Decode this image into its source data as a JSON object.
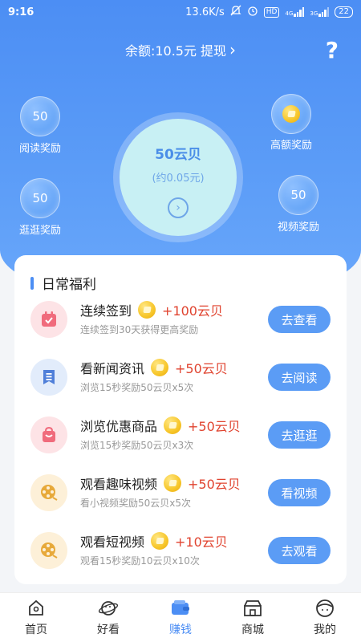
{
  "status_bar": {
    "time": "9:16",
    "speed": "13.6K/s",
    "hd": "HD",
    "net1": "4G",
    "net2": "3G",
    "battery": "22"
  },
  "header": {
    "balance_text": "余额:10.5元 提现",
    "help": "?"
  },
  "rewards": {
    "read": {
      "value": "50",
      "label": "阅读奖励"
    },
    "browse": {
      "value": "50",
      "label": "逛逛奖励"
    },
    "high": {
      "label": "高额奖励"
    },
    "video": {
      "value": "50",
      "label": "视频奖励"
    }
  },
  "center": {
    "amount": "50云贝",
    "approx": "(约0.05元)"
  },
  "daily": {
    "title": "日常福利",
    "tasks": [
      {
        "name": "连续签到",
        "reward": "+100云贝",
        "desc": "连续签到30天获得更高奖励",
        "button": "去查看",
        "icon": "calendar-icon"
      },
      {
        "name": "看新闻资讯",
        "reward": "+50云贝",
        "desc": "浏览15秒奖励50云贝x5次",
        "button": "去阅读",
        "icon": "news-icon"
      },
      {
        "name": "浏览优惠商品",
        "reward": "+50云贝",
        "desc": "浏览15秒奖励50云贝x3次",
        "button": "去逛逛",
        "icon": "shopping-bag-icon"
      },
      {
        "name": "观看趣味视频",
        "reward": "+50云贝",
        "desc": "看小视频奖励50云贝x5次",
        "button": "看视频",
        "icon": "film-reel-icon"
      },
      {
        "name": "观看短视频",
        "reward": "+10云贝",
        "desc": "观看15秒奖励10云贝x10次",
        "button": "去观看",
        "icon": "film-reel-icon"
      }
    ]
  },
  "tabbar": {
    "tabs": [
      {
        "label": "首页",
        "icon": "home-icon"
      },
      {
        "label": "好看",
        "icon": "planet-icon"
      },
      {
        "label": "赚钱",
        "icon": "wallet-icon"
      },
      {
        "label": "商城",
        "icon": "store-icon"
      },
      {
        "label": "我的",
        "icon": "profile-icon"
      }
    ],
    "active_index": 2
  },
  "colors": {
    "primary": "#4c8ef4",
    "reward_red": "#e0432f",
    "coin_gold": "#f7c62a"
  }
}
